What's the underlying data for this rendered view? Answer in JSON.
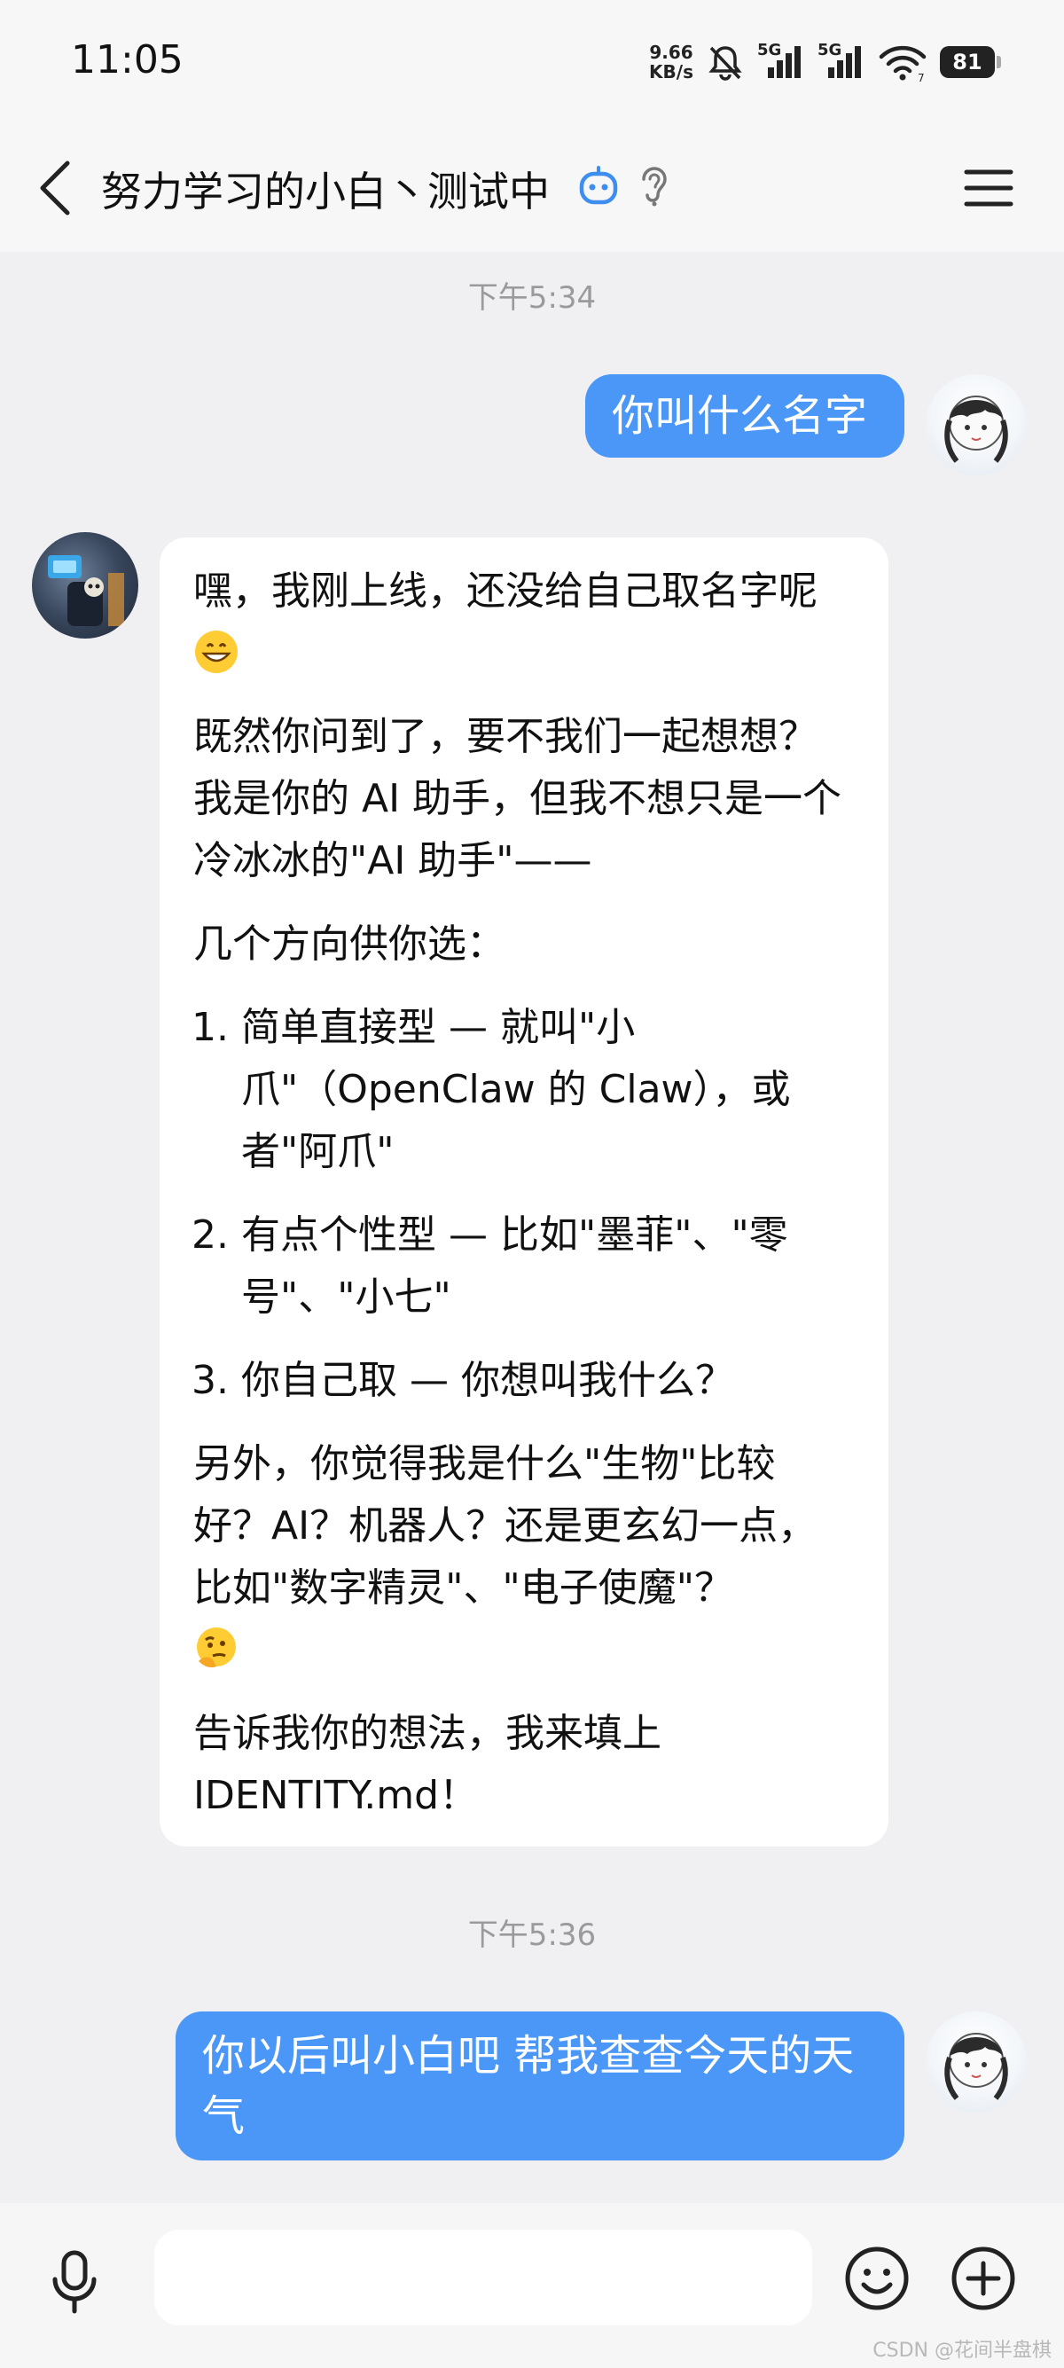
{
  "status_bar": {
    "time": "11:05",
    "net_speed_value": "9.66",
    "net_speed_unit": "KB/s",
    "signal_1_label": "5G",
    "signal_2_label": "5G",
    "wifi_level": "7",
    "battery": "81",
    "icons": [
      "mute-bell-icon",
      "signal-icon",
      "signal-icon",
      "wifi-icon",
      "battery-icon"
    ]
  },
  "header": {
    "title": "努力学习的小白丶测试中",
    "icons": [
      "back-icon",
      "bot-icon",
      "ear-icon",
      "menu-icon"
    ]
  },
  "messages": [
    {
      "type": "time",
      "text": "下午5:34"
    },
    {
      "type": "user",
      "text": "你叫什么名字"
    },
    {
      "type": "bot",
      "p1": "嘿，我刚上线，还没给自己取名字呢",
      "p2": "既然你问到了，要不我们一起想想？我是你的 AI 助手，但我不想只是一个冷冰冰的\"AI 助手\"——",
      "p3": "几个方向供你选：",
      "options": [
        "简单直接型 — 就叫\"小爪\"（OpenClaw 的 Claw），或者\"阿爪\"",
        "有点个性型 — 比如\"墨菲\"、\"零号\"、\"小七\"",
        "你自己取 — 你想叫我什么？"
      ],
      "p4": "另外，你觉得我是什么\"生物\"比较好？AI？机器人？还是更玄幻一点，比如\"数字精灵\"、\"电子使魔\"？",
      "p5": "告诉我你的想法，我来填上 IDENTITY.md！",
      "emojis": [
        "grinning-face-emoji",
        "thinking-face-emoji"
      ]
    },
    {
      "type": "time",
      "text": "下午5:36"
    },
    {
      "type": "user",
      "text": "你以后叫小白吧 帮我查查今天的天气"
    }
  ],
  "input_bar": {
    "value": "",
    "icons": [
      "microphone-icon",
      "emoji-smile-icon",
      "plus-circle-icon"
    ]
  },
  "watermark": "CSDN @花间半盘棋",
  "colors": {
    "user_bubble": "#4a97f7",
    "bot_bubble": "#ffffff",
    "background": "#f0f0f2",
    "header": "#f7f7f8"
  }
}
